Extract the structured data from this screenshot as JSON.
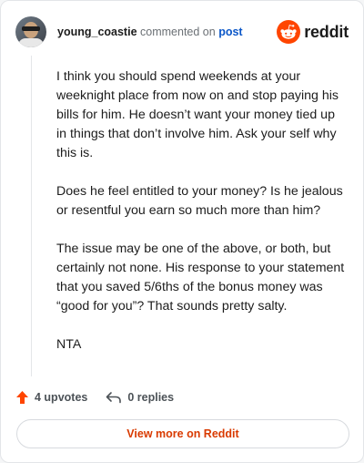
{
  "comment": {
    "username": "young_coastie",
    "action_text": "commented on",
    "post_link": "post",
    "paragraphs": [
      "I think you should spend weekends at your weeknight place from now on and stop paying his bills for him. He doesn’t want your money tied up in things that don’t involve him. Ask your self why this is.",
      "Does he feel entitled to your money? Is he jealous or resentful you earn so much more than him?",
      "The issue may be one of the above, or both, but certainly not none. His response to your statement that you saved 5/6ths of the bonus money was “good for you”? That sounds pretty salty.",
      "NTA"
    ]
  },
  "brand": {
    "name": "reddit",
    "icon": "reddit-snoo-icon",
    "color": "#ff4500"
  },
  "actions": {
    "upvotes": "4 upvotes",
    "upvote_icon": "upvote-arrow-icon",
    "upvote_color": "#ff4500",
    "replies": "0 replies",
    "reply_icon": "reply-arrow-icon"
  },
  "footer": {
    "view_more": "View more on Reddit",
    "link_color": "#d93a00"
  }
}
